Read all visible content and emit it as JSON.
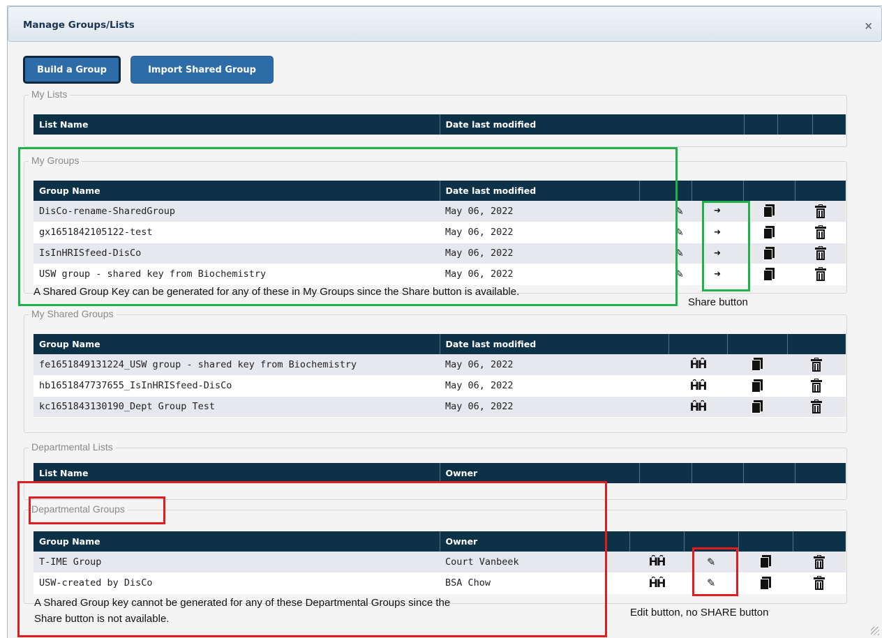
{
  "dialog": {
    "title": "Manage Groups/Lists",
    "close_icon": "×"
  },
  "toolbar": {
    "build_group": "Build a Group",
    "import_shared_group": "Import Shared Group"
  },
  "my_lists": {
    "legend": "My Lists",
    "columns": [
      "List Name",
      "Date last modified",
      "",
      "",
      ""
    ]
  },
  "my_groups": {
    "legend": "My Groups",
    "columns": [
      "Group Name",
      "Date last modified",
      "",
      "",
      "",
      ""
    ],
    "rows": [
      {
        "name": "DisCo-rename-SharedGroup",
        "date": "May 06, 2022"
      },
      {
        "name": "gx1651842105122-test",
        "date": "May 06, 2022"
      },
      {
        "name": "IsInHRISfeed-DisCo",
        "date": "May 06, 2022"
      },
      {
        "name": "USW group - shared key from Biochemistry",
        "date": "May 06, 2022"
      }
    ]
  },
  "my_shared_groups": {
    "legend": "My Shared Groups",
    "columns": [
      "Group Name",
      "Date last modified",
      "",
      "",
      ""
    ],
    "rows": [
      {
        "name": "fe1651849131224_USW group - shared key from Biochemistry",
        "date": "May 06, 2022"
      },
      {
        "name": "hb1651847737655_IsInHRISfeed-DisCo",
        "date": "May 06, 2022"
      },
      {
        "name": "kc1651843130190_Dept Group Test",
        "date": "May 06, 2022"
      }
    ]
  },
  "departmental_lists": {
    "legend": "Departmental Lists",
    "columns": [
      "List Name",
      "Owner",
      "",
      "",
      "",
      ""
    ]
  },
  "departmental_groups": {
    "legend": "Departmental Groups",
    "columns": [
      "Group Name",
      "Owner",
      "",
      "",
      "",
      ""
    ],
    "rows": [
      {
        "name": "T-IME Group",
        "owner": "Court Vanbeek"
      },
      {
        "name": "USW-created by DisCo",
        "owner": "BSA Chow"
      }
    ]
  },
  "icons": {
    "edit": "pencil-icon",
    "share": "share-arrow-icon",
    "copy": "copy-icon",
    "delete": "trash-icon",
    "view": "binoculars-icon",
    "pencil_glyph": "✎",
    "arrow_glyph": "➜",
    "binoc_glyph": "ñ"
  },
  "annotations": {
    "my_groups_note": "A Shared Group Key can be generated for any of these in My Groups since the Share button is available.",
    "share_label": "Share button",
    "dept_note_line1": "A Shared Group key cannot be generated for any of these Departmental Groups since the",
    "dept_note_line2": "Share button is not available.",
    "edit_label": "Edit button, no SHARE button"
  },
  "colors": {
    "header": "#0d3147",
    "button": "#2e6ca8",
    "green_annotation": "#1fb24a",
    "red_annotation": "#e21c1c"
  }
}
